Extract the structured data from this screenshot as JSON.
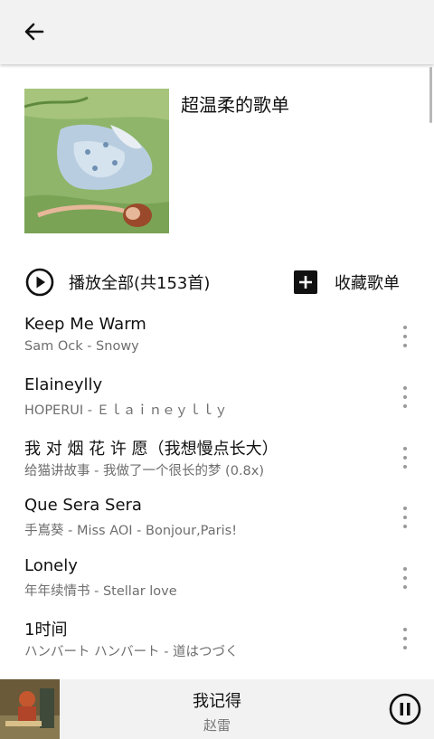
{
  "header": {
    "back_icon": "arrow-left-icon"
  },
  "playlist": {
    "title": "超温柔的歌单",
    "cover_icon": "album-cover-illustration"
  },
  "actions": {
    "play_all_label": "播放全部(共153首)",
    "play_all_icon": "play-circle-icon",
    "collect_label": "收藏歌单",
    "collect_icon": "plus-square-icon"
  },
  "songs": [
    {
      "title": "Keep Me Warm",
      "subtitle": "Sam Ock - Snowy"
    },
    {
      "title": "Elaineylly",
      "subtitle": "HOPERUI - Ｅｌａｉｎｅｙｌｌｙ"
    },
    {
      "title": "我 对 烟 花 许 愿（我想慢点长大）",
      "subtitle": "给猫讲故事 - 我做了一个很长的梦 (0.8x)"
    },
    {
      "title": "Que Sera Sera",
      "subtitle": "手嶌葵 - Miss AOI - Bonjour,Paris!"
    },
    {
      "title": "Lonely",
      "subtitle": "年年续情书 - Stellar love"
    },
    {
      "title": "1时间",
      "subtitle": "ハンバート ハンバート - 道はつづく"
    }
  ],
  "player": {
    "song": "我记得",
    "artist": "赵雷",
    "pause_icon": "pause-circle-icon"
  },
  "colors": {
    "topbar_bg": "#f2f2f2",
    "player_bg": "#f2f2f2",
    "subtitle": "#6e6e6e"
  }
}
